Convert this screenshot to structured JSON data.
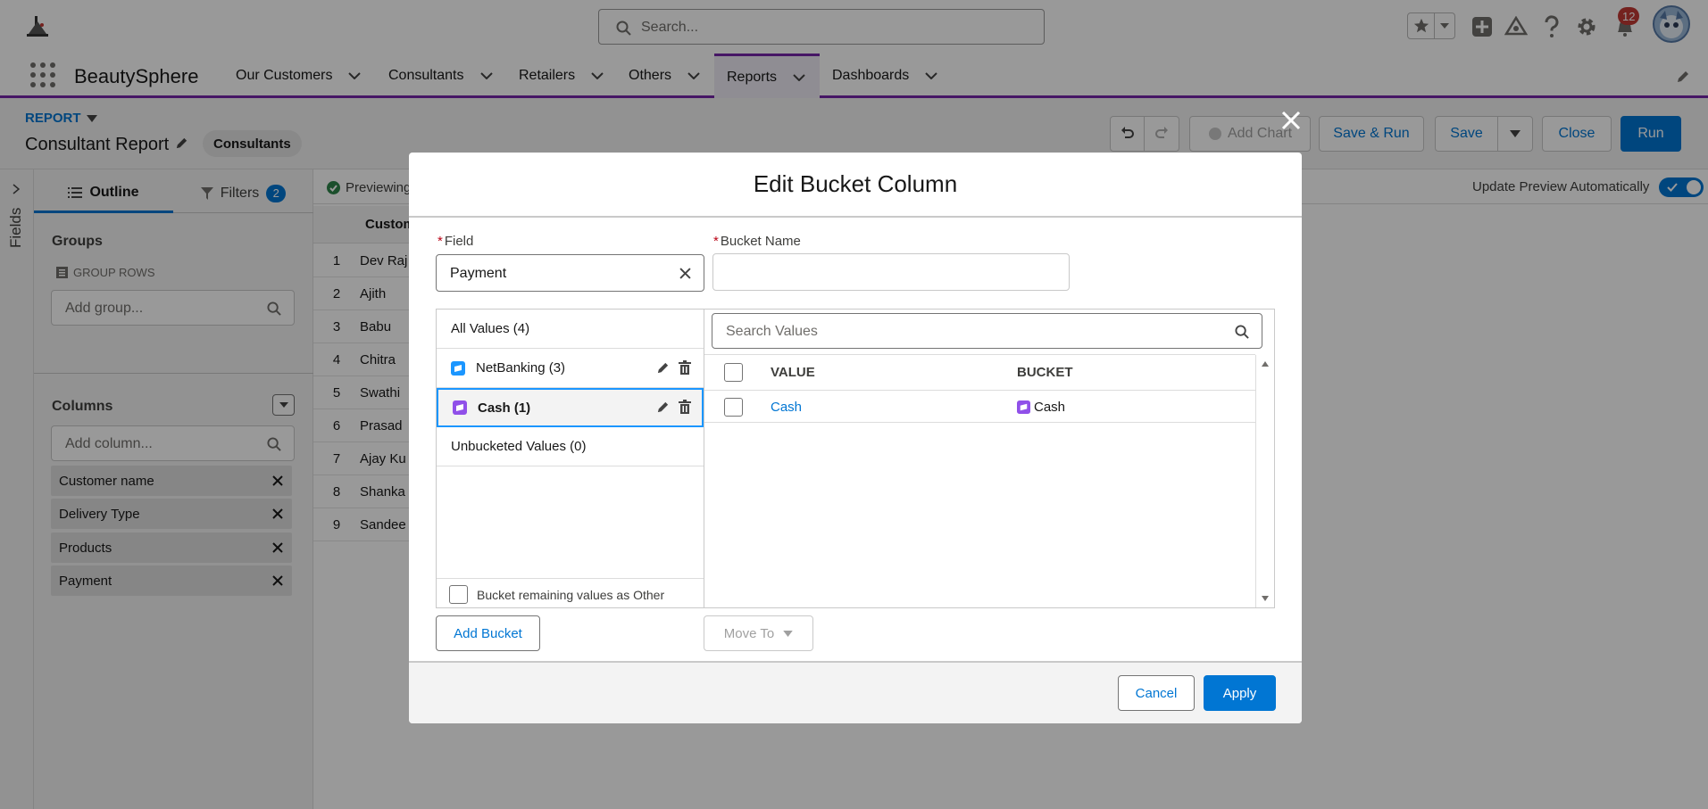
{
  "app": {
    "name": "BeautySphere",
    "search_placeholder": "Search...",
    "notification_count": "12"
  },
  "nav": {
    "tabs": [
      {
        "label": "Our Customers"
      },
      {
        "label": "Consultants"
      },
      {
        "label": "Retailers"
      },
      {
        "label": "Others"
      },
      {
        "label": "Reports"
      },
      {
        "label": "Dashboards"
      }
    ],
    "active_tab": "Reports"
  },
  "report": {
    "type_label": "REPORT",
    "title": "Consultant Report",
    "report_type_chip": "Consultants",
    "toolbar": {
      "add_chart": "Add Chart",
      "save_run": "Save & Run",
      "save": "Save",
      "close": "Close",
      "run": "Run"
    },
    "preview_text": "Previewing",
    "update_preview_label": "Update Preview Automatically",
    "update_preview_on": true
  },
  "left_panel": {
    "fields_rail_label": "Fields",
    "outline_tab": "Outline",
    "filters_tab": "Filters",
    "filters_count": "2",
    "groups_heading": "Groups",
    "group_rows_label": "GROUP ROWS",
    "add_group_placeholder": "Add group...",
    "columns_heading": "Columns",
    "add_column_placeholder": "Add column...",
    "columns": [
      {
        "label": "Customer name"
      },
      {
        "label": "Delivery Type"
      },
      {
        "label": "Products"
      },
      {
        "label": "Payment"
      }
    ]
  },
  "table": {
    "header": "Custom",
    "rows": [
      {
        "num": "1",
        "name": "Dev Raj"
      },
      {
        "num": "2",
        "name": "Ajith"
      },
      {
        "num": "3",
        "name": "Babu"
      },
      {
        "num": "4",
        "name": "Chitra"
      },
      {
        "num": "5",
        "name": "Swathi"
      },
      {
        "num": "6",
        "name": "Prasad"
      },
      {
        "num": "7",
        "name": "Ajay Ku"
      },
      {
        "num": "8",
        "name": "Shanka"
      },
      {
        "num": "9",
        "name": "Sandee"
      }
    ]
  },
  "modal": {
    "title": "Edit Bucket Column",
    "field_label": "Field",
    "field_value": "Payment",
    "bucket_name_label": "Bucket Name",
    "bucket_name_value": "",
    "buckets": {
      "all_values": "All Values (4)",
      "items": [
        {
          "label": "NetBanking (3)",
          "selected": false
        },
        {
          "label": "Cash (1)",
          "selected": true
        }
      ],
      "unbucketed": "Unbucketed Values (0)",
      "remaining_other_label": "Bucket remaining values as Other"
    },
    "search_values_placeholder": "Search Values",
    "value_col_header": "VALUE",
    "bucket_col_header": "BUCKET",
    "value_rows": [
      {
        "value": "Cash",
        "bucket": "Cash"
      }
    ],
    "add_bucket": "Add Bucket",
    "move_to": "Move To",
    "cancel": "Cancel",
    "apply": "Apply"
  },
  "colors": {
    "brand": "#0176d3",
    "nav_accent": "#7526a8",
    "bucket_icon_netbanking": "#1b96ff",
    "bucket_icon_cash": "#9050e9"
  }
}
